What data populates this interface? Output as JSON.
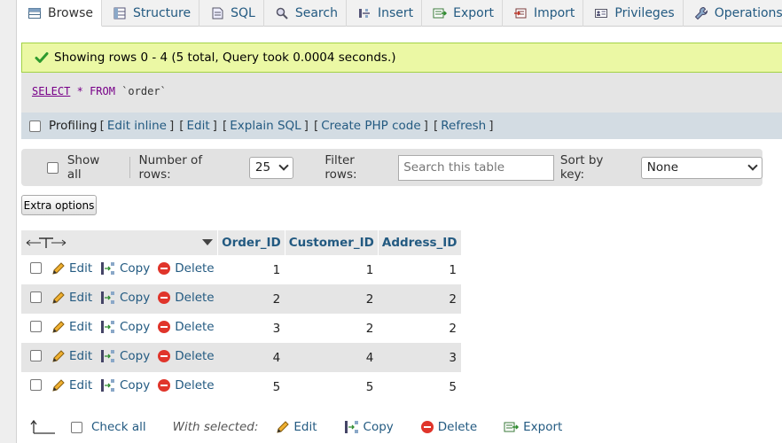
{
  "tabs": [
    {
      "label": "Browse",
      "icon": "browse-icon",
      "active": true
    },
    {
      "label": "Structure",
      "icon": "structure-icon"
    },
    {
      "label": "SQL",
      "icon": "sql-icon"
    },
    {
      "label": "Search",
      "icon": "search-icon"
    },
    {
      "label": "Insert",
      "icon": "insert-icon"
    },
    {
      "label": "Export",
      "icon": "export-icon"
    },
    {
      "label": "Import",
      "icon": "import-icon"
    },
    {
      "label": "Privileges",
      "icon": "privileges-icon"
    },
    {
      "label": "Operations",
      "icon": "operations-icon"
    }
  ],
  "message": {
    "text": "Showing rows 0 - 4 (5 total, Query took 0.0004 seconds.)"
  },
  "sql": {
    "keyword_select": "SELECT",
    "star": "*",
    "keyword_from": "FROM",
    "table": "`order`"
  },
  "profiling": {
    "label": "Profiling",
    "links": [
      "Edit inline",
      "Edit",
      "Explain SQL",
      "Create PHP code",
      "Refresh"
    ]
  },
  "nav": {
    "show_all": "Show all",
    "rows_label": "Number of rows:",
    "rows_value": "25",
    "filter_label": "Filter rows:",
    "filter_placeholder": "Search this table",
    "sort_label": "Sort by key:",
    "sort_value": "None"
  },
  "extra_options": "Extra options",
  "table": {
    "columns": [
      "Order_ID",
      "Customer_ID",
      "Address_ID"
    ],
    "actions": {
      "edit": "Edit",
      "copy": "Copy",
      "delete": "Delete"
    },
    "rows": [
      [
        "1",
        "1",
        "1"
      ],
      [
        "2",
        "2",
        "2"
      ],
      [
        "3",
        "2",
        "2"
      ],
      [
        "4",
        "4",
        "3"
      ],
      [
        "5",
        "5",
        "5"
      ]
    ]
  },
  "bottom": {
    "check_all": "Check all",
    "with_selected": "With selected:",
    "edit": "Edit",
    "copy": "Copy",
    "delete": "Delete",
    "export": "Export"
  },
  "colors": {
    "link": "#235a81",
    "success_bg": "#ebf8a4",
    "success_border": "#a2d246",
    "delete_red": "#e0352b"
  }
}
